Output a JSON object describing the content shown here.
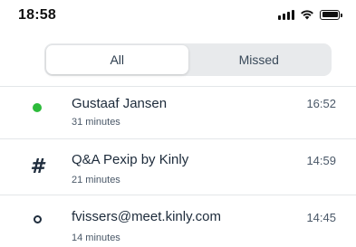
{
  "status_bar": {
    "time": "18:58",
    "icons": [
      "signal-icon",
      "wifi-icon",
      "battery-icon"
    ]
  },
  "filter": {
    "tabs": [
      {
        "label": "All",
        "selected": true
      },
      {
        "label": "Missed",
        "selected": false
      }
    ]
  },
  "calls": [
    {
      "name": "Gustaaf Jansen",
      "duration": "31 minutes",
      "time": "16:52",
      "icon": "online-status-dot-icon",
      "icon_color": "#2dbb3b"
    },
    {
      "name": "Q&A Pexip by Kinly",
      "duration": "21 minutes",
      "time": "14:59",
      "icon": "hash-room-icon"
    },
    {
      "name": "fvissers@meet.kinly.com",
      "duration": "14 minutes",
      "time": "14:45",
      "icon": "offline-status-ring-icon"
    }
  ],
  "colors": {
    "text_primary": "#1c2a3a",
    "segment_bg": "#e8eaec",
    "online_green": "#2dbb3b"
  }
}
